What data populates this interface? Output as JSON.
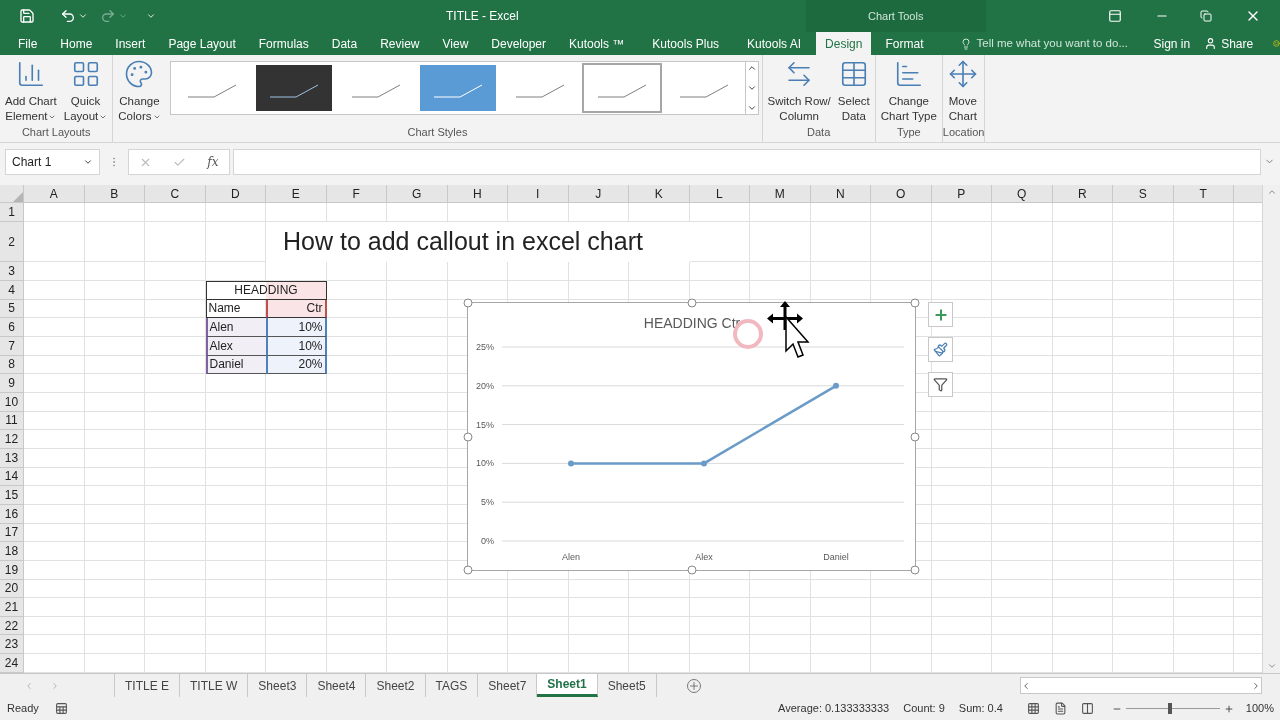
{
  "title_bar": {
    "title": "TITLE - Excel",
    "context_label": "Chart Tools"
  },
  "menu_tabs": [
    {
      "label": "File",
      "selected": false
    },
    {
      "label": "Home",
      "selected": false
    },
    {
      "label": "Insert",
      "selected": false
    },
    {
      "label": "Page Layout",
      "selected": false
    },
    {
      "label": "Formulas",
      "selected": false
    },
    {
      "label": "Data",
      "selected": false
    },
    {
      "label": "Review",
      "selected": false
    },
    {
      "label": "View",
      "selected": false
    },
    {
      "label": "Developer",
      "selected": false
    },
    {
      "label": "Kutools ™",
      "selected": false
    },
    {
      "label": "Kutools Plus",
      "selected": false
    },
    {
      "label": "Kutools AI",
      "selected": false
    },
    {
      "label": "Design",
      "selected": true
    },
    {
      "label": "Format",
      "selected": false
    }
  ],
  "tell_me": {
    "placeholder": "Tell me what you want to do..."
  },
  "sign_in": "Sign in",
  "share": "Share",
  "ribbon_groups": [
    {
      "label": "Chart Layouts",
      "buttons": [
        {
          "lines": [
            "Add Chart",
            "Element"
          ],
          "dropdown": true
        },
        {
          "lines": [
            "Quick",
            "Layout"
          ],
          "dropdown": true
        }
      ]
    },
    {
      "label": "Chart Styles",
      "buttons": [
        {
          "lines": [
            "Change",
            "Colors"
          ],
          "dropdown": true
        }
      ],
      "gallery": [
        {
          "kind": "light",
          "selected": false
        },
        {
          "kind": "dark",
          "selected": false
        },
        {
          "kind": "light",
          "selected": false
        },
        {
          "kind": "blue",
          "selected": false
        },
        {
          "kind": "light",
          "selected": false
        },
        {
          "kind": "light",
          "selected": true
        },
        {
          "kind": "light",
          "selected": false
        }
      ]
    },
    {
      "label": "Data",
      "buttons": [
        {
          "lines": [
            "Switch Row/",
            "Column"
          ],
          "dropdown": false
        },
        {
          "lines": [
            "Select",
            "Data"
          ],
          "dropdown": false
        }
      ]
    },
    {
      "label": "Type",
      "buttons": [
        {
          "lines": [
            "Change",
            "Chart Type"
          ],
          "dropdown": false
        }
      ]
    },
    {
      "label": "Location",
      "buttons": [
        {
          "lines": [
            "Move",
            "Chart"
          ],
          "dropdown": false
        }
      ]
    }
  ],
  "name_box": "Chart 1",
  "function_label": "fx",
  "columns": [
    "A",
    "B",
    "C",
    "D",
    "E",
    "F",
    "G",
    "H",
    "I",
    "J",
    "K",
    "L",
    "M",
    "N",
    "O",
    "P",
    "Q",
    "R",
    "S",
    "T"
  ],
  "rows": [
    "1",
    "2",
    "3",
    "4",
    "5",
    "6",
    "7",
    "8",
    "9",
    "10",
    "11",
    "12",
    "13",
    "14",
    "15",
    "16",
    "17",
    "18",
    "19",
    "20",
    "21",
    "22",
    "23",
    "24"
  ],
  "sheet_title": "How to add callout in excel chart",
  "table": {
    "heading": "HEADDING",
    "columns": [
      "Name",
      "Ctr"
    ],
    "rows": [
      [
        "Alen",
        "10%"
      ],
      [
        "Alex",
        "10%"
      ],
      [
        "Daniel",
        "20%"
      ]
    ]
  },
  "chart": {
    "chart_data": {
      "type": "line",
      "title": "HEADDING Ctr",
      "categories": [
        "Alen",
        "Alex",
        "Daniel"
      ],
      "grid": true,
      "series": [
        {
          "color": "#6b9bc8",
          "marker": true,
          "values": [
            0.1,
            0.1,
            0.2
          ]
        }
      ],
      "ylim": [
        0,
        0.25
      ],
      "yticks": [
        {
          "value": 0,
          "label": "0%"
        },
        {
          "value": 0.05,
          "label": "5%"
        },
        {
          "value": 0.1,
          "label": "10%"
        },
        {
          "value": 0.15,
          "label": "15%"
        },
        {
          "value": 0.2,
          "label": "20%"
        },
        {
          "value": 0.25,
          "label": "25%"
        }
      ]
    }
  },
  "sheet_tabs": [
    {
      "label": "TITLE E",
      "selected": false
    },
    {
      "label": "TITLE W",
      "selected": false
    },
    {
      "label": "Sheet3",
      "selected": false
    },
    {
      "label": "Sheet4",
      "selected": false
    },
    {
      "label": "Sheet2",
      "selected": false
    },
    {
      "label": "TAGS",
      "selected": false
    },
    {
      "label": "Sheet7",
      "selected": false
    },
    {
      "label": "Sheet1",
      "selected": true
    },
    {
      "label": "Sheet5",
      "selected": false
    }
  ],
  "status_bar": {
    "status": "Ready",
    "average": "Average: 0.133333333",
    "count": "Count: 9",
    "sum": "Sum: 0.4",
    "zoom": "100%",
    "zoom_slider": {
      "level": 0.45
    }
  }
}
